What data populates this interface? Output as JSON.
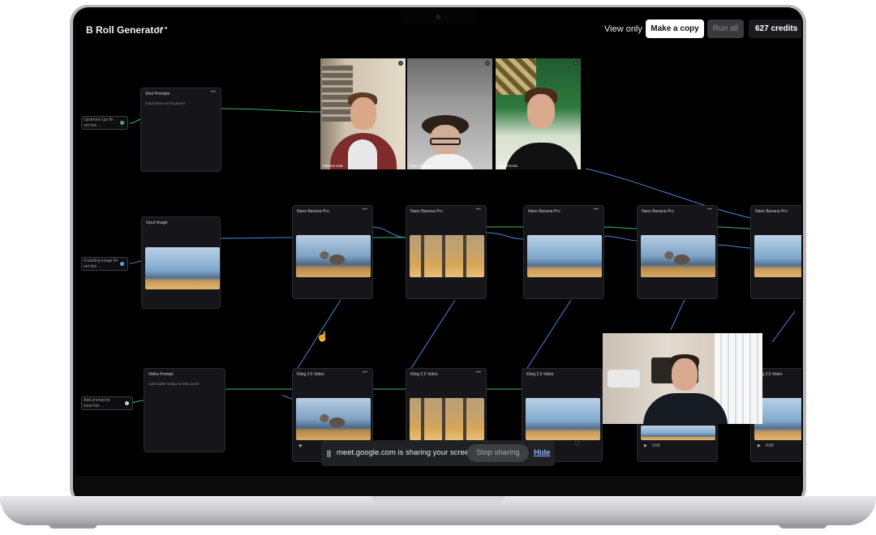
{
  "app": {
    "title": "B Roll Generator",
    "more_label": "•••",
    "view_only": "View only",
    "make_copy": "Make a copy",
    "run_all": "Run all",
    "credits": "627 credits"
  },
  "side_inputs": [
    {
      "line1": "Upstream (ps fin",
      "line2": "ont fois →"
    },
    {
      "line1": "d starting image fin",
      "line2": "ont fois →"
    },
    {
      "line1": "Add prompt for",
      "line2": "ional fois →"
    }
  ],
  "nodes": {
    "prompt": {
      "title": "Shot Prompts",
      "body": "Good shots at the places"
    },
    "input_image": {
      "title": "Input Image"
    },
    "video_prompt": {
      "title": "Video Prompt",
      "body": "Add subtle motion to this scene"
    },
    "image_model_label": "Nano Banana Pro",
    "video_model_label": "Kling 2.5 Video",
    "video_model_label_alt": "Kling 2.5 Video",
    "menu": "•••",
    "player_time": "0:00"
  },
  "participants": [
    {
      "name": "Klemen Kaic"
    },
    {
      "name": "Nejc Angelkov"
    },
    {
      "name": "Jakob Kocic"
    }
  ],
  "share_bar": {
    "pause": "||",
    "text": "meet.google.com is sharing your screen.",
    "stop": "Stop sharing",
    "hide": "Hide"
  },
  "icons": {
    "cursor": "hand-cursor-icon",
    "mic_off": "mic-off-icon",
    "play": "play-icon"
  },
  "colors": {
    "background": "#000000",
    "edge_green": "#3fb36b",
    "edge_blue": "#4a86d6",
    "link_blue": "#8ab4f8"
  }
}
